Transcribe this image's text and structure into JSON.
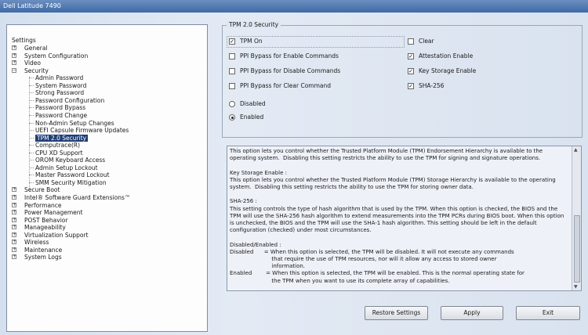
{
  "window": {
    "title": "Dell Latitude 7490"
  },
  "tree": {
    "title": "Settings",
    "items": [
      {
        "label": "General",
        "level": 0,
        "expander": "+"
      },
      {
        "label": "System Configuration",
        "level": 0,
        "expander": "+"
      },
      {
        "label": "Video",
        "level": 0,
        "expander": "+"
      },
      {
        "label": "Security",
        "level": 0,
        "expander": "−"
      },
      {
        "label": "Admin Password",
        "level": 1
      },
      {
        "label": "System Password",
        "level": 1
      },
      {
        "label": "Strong Password",
        "level": 1
      },
      {
        "label": "Password Configuration",
        "level": 1
      },
      {
        "label": "Password Bypass",
        "level": 1
      },
      {
        "label": "Password Change",
        "level": 1
      },
      {
        "label": "Non-Admin Setup Changes",
        "level": 1
      },
      {
        "label": "UEFI Capsule Firmware Updates",
        "level": 1
      },
      {
        "label": "TPM 2.0 Security",
        "level": 1,
        "selected": true
      },
      {
        "label": "Computrace(R)",
        "level": 1
      },
      {
        "label": "CPU XD Support",
        "level": 1
      },
      {
        "label": "OROM Keyboard Access",
        "level": 1
      },
      {
        "label": "Admin Setup Lockout",
        "level": 1
      },
      {
        "label": "Master Password Lockout",
        "level": 1
      },
      {
        "label": "SMM Security Mitigation",
        "level": 1
      },
      {
        "label": "Secure Boot",
        "level": 0,
        "expander": "+"
      },
      {
        "label": "Intel® Software Guard Extensions™",
        "level": 0,
        "expander": "+"
      },
      {
        "label": "Performance",
        "level": 0,
        "expander": "+"
      },
      {
        "label": "Power Management",
        "level": 0,
        "expander": "+"
      },
      {
        "label": "POST Behavior",
        "level": 0,
        "expander": "+"
      },
      {
        "label": "Manageability",
        "level": 0,
        "expander": "+"
      },
      {
        "label": "Virtualization Support",
        "level": 0,
        "expander": "+"
      },
      {
        "label": "Wireless",
        "level": 0,
        "expander": "+"
      },
      {
        "label": "Maintenance",
        "level": 0,
        "expander": "+"
      },
      {
        "label": "System Logs",
        "level": 0,
        "expander": "+"
      }
    ]
  },
  "tpm": {
    "group_title": "TPM 2.0 Security",
    "left_options": [
      {
        "label": "TPM On",
        "checked": true
      },
      {
        "label": "PPI Bypass for Enable Commands",
        "checked": false
      },
      {
        "label": "PPI Bypass for Disable Commands",
        "checked": false
      },
      {
        "label": "PPI Bypass for Clear Command",
        "checked": false
      }
    ],
    "right_options": [
      {
        "label": "Clear",
        "checked": false
      },
      {
        "label": "Attestation Enable",
        "checked": true
      },
      {
        "label": "Key Storage Enable",
        "checked": true
      },
      {
        "label": "SHA-256",
        "checked": true
      }
    ],
    "radios": [
      {
        "label": "Disabled",
        "selected": false
      },
      {
        "label": "Enabled",
        "selected": true
      }
    ]
  },
  "help": {
    "text": "This option lets you control whether the Trusted Platform Module (TPM) Endorsement Hierarchy is available to the operating system.  Disabling this setting restricts the ability to use the TPM for signing and signature operations.\n\nKey Storage Enable :\nThis option lets you control whether the Trusted Platform Module (TPM) Storage Hierarchy is available to the operating system.  Disabling this setting restricts the ability to use the TPM for storing owner data.\n\nSHA-256 :\nThis setting controls the type of hash algorithm that is used by the TPM. When this option is checked, the BIOS and the TPM will use the SHA-256 hash algorithm to extend measurements into the TPM PCRs during BIOS boot. When this option is unchecked, the BIOS and the TPM will use the SHA-1 hash algorithm. This setting should be left in the default configuration (checked) under most circumstances.\n\nDisabled/Enabled :\nDisabled      = When this option is selected, the TPM will be disabled. It will not execute any commands\n                        that require the use of TPM resources, nor will it allow any access to stored owner\n                        information.\nEnabled        = When this option is selected, the TPM will be enabled. This is the normal operating state for\n                        the TPM when you want to use its complete array of capabilities."
  },
  "buttons": {
    "restore": "Restore Settings",
    "apply": "Apply",
    "exit": "Exit"
  },
  "colors": {
    "selection": "#1f3f76",
    "titlebar": "#3f6aa6"
  }
}
